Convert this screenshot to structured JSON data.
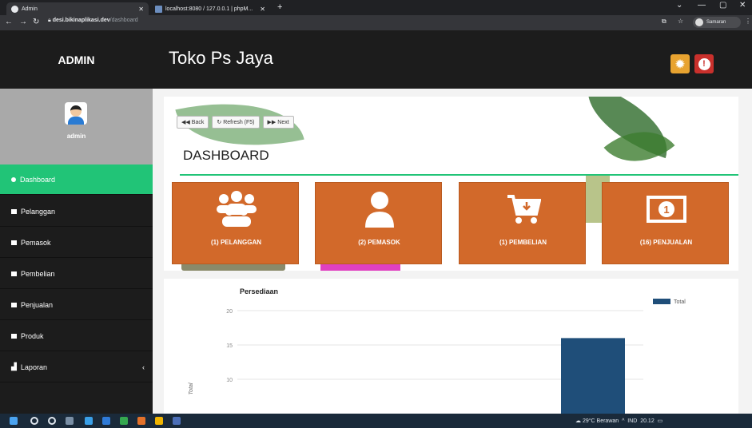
{
  "browser": {
    "tabs": [
      {
        "title": "Admin"
      },
      {
        "title": "localhost:8080 / 127.0.0.1 | phpM..."
      }
    ],
    "url_domain": "desi.bikinaplikasi.dev",
    "url_path": "/dashboard",
    "profile_name": "Samaran"
  },
  "header": {
    "brand": "ADMIN",
    "shop_name": "Toko Ps Jaya"
  },
  "sidebar": {
    "user": "admin",
    "items": [
      {
        "label": "Dashboard"
      },
      {
        "label": "Pelanggan"
      },
      {
        "label": "Pemasok"
      },
      {
        "label": "Pembelian"
      },
      {
        "label": "Penjualan"
      },
      {
        "label": "Produk"
      },
      {
        "label": "Laporan"
      }
    ]
  },
  "main": {
    "toolbar": {
      "back": "Back",
      "refresh": "Refresh (F5)",
      "next": "Next"
    },
    "title": "DASHBOARD",
    "cards": [
      {
        "label": "(1) PELANGGAN",
        "icon": "users-icon"
      },
      {
        "label": "(2) PEMASOK",
        "icon": "user-icon"
      },
      {
        "label": "(1) PEMBELIAN",
        "icon": "cart-icon"
      },
      {
        "label": "(16) PENJUALAN",
        "icon": "money-icon"
      }
    ]
  },
  "chart_data": {
    "type": "bar",
    "title": "Persediaan",
    "ylabel": "Total",
    "series": [
      {
        "name": "Total",
        "values": [
          16
        ]
      }
    ],
    "categories": [
      ""
    ],
    "yticks": [
      20,
      15,
      10
    ],
    "ylim": [
      0,
      20
    ],
    "bar_color": "#1f4e79"
  },
  "taskbar": {
    "weather": "29°C Berawan",
    "tray": "IND",
    "time": "20.12"
  },
  "colors": {
    "active_menu": "#21c477",
    "card_orange": "#d2692a",
    "settings_btn": "#e8a330",
    "alert_btn": "#c9302c"
  }
}
